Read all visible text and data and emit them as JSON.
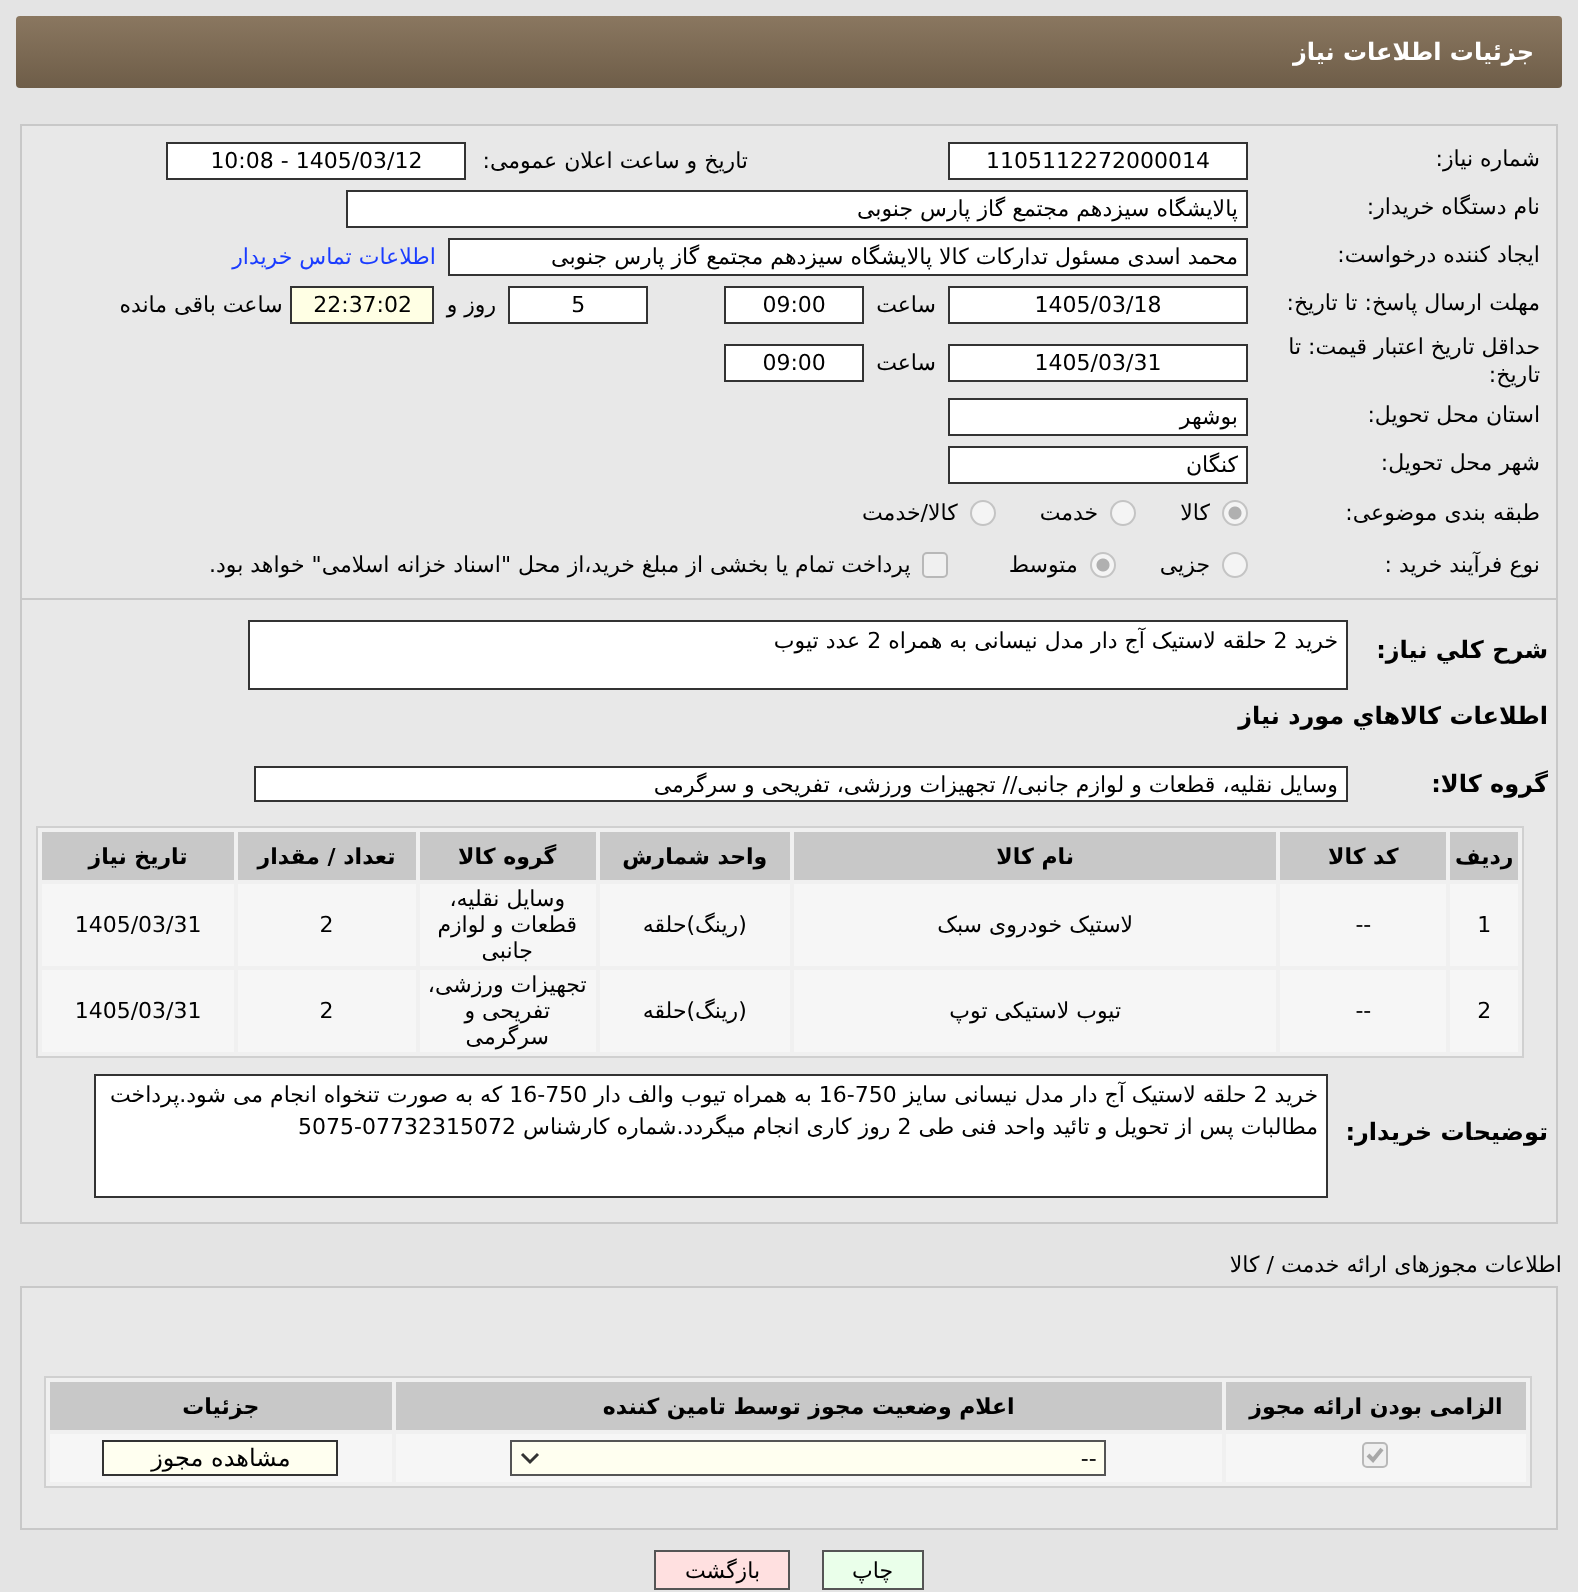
{
  "header": {
    "title": "جزئیات اطلاعات نیاز"
  },
  "form": {
    "need_number": {
      "label": "شماره نیاز:",
      "value": "1105112272000014"
    },
    "announce": {
      "label": "تاریخ و ساعت اعلان عمومی:",
      "value": "1405/03/12 - 10:08"
    },
    "buyer": {
      "label": "نام دستگاه خریدار:",
      "value": "پالایشگاه سیزدهم مجتمع گاز پارس جنوبی"
    },
    "creator": {
      "label": "ایجاد کننده درخواست:",
      "value": "محمد اسدی مسئول تدارکات کالا پالایشگاه سیزدهم مجتمع گاز پارس جنوبی",
      "link": "اطلاعات تماس خریدار"
    },
    "deadline": {
      "label": "مهلت ارسال پاسخ: تا تاریخ:",
      "date": "1405/03/18",
      "time_label": "ساعت",
      "time": "09:00",
      "days": "5",
      "days_label": "روز و",
      "remaining": "22:37:02",
      "remaining_label": "ساعت باقی مانده"
    },
    "validity": {
      "label": "حداقل تاریخ اعتبار قیمت: تا تاریخ:",
      "date": "1405/03/31",
      "time_label": "ساعت",
      "time": "09:00"
    },
    "province": {
      "label": "استان محل تحویل:",
      "value": "بوشهر"
    },
    "city": {
      "label": "شهر محل تحویل:",
      "value": "کنگان"
    },
    "category": {
      "label": "طبقه بندی موضوعی:",
      "options": [
        {
          "label": "کالا",
          "selected": true
        },
        {
          "label": "خدمت",
          "selected": false
        },
        {
          "label": "کالا/خدمت",
          "selected": false
        }
      ]
    },
    "process": {
      "label": "نوع فرآیند خرید :",
      "options": [
        {
          "label": "جزیی",
          "selected": false
        },
        {
          "label": "متوسط",
          "selected": true
        }
      ],
      "payment": {
        "checked": false,
        "label": "پرداخت تمام یا بخشی از مبلغ خرید،از محل \"اسناد خزانه اسلامی\" خواهد بود."
      }
    }
  },
  "summary": {
    "description": {
      "label": "شرح كلي نياز:",
      "value": "خرید 2 حلقه لاستیک آج دار مدل نیسانی به همراه 2 عدد تیوب"
    },
    "items_title": "اطلاعات كالاهاي مورد نياز",
    "goods_group": {
      "label": "گروه کالا:",
      "value": "وسایل نقلیه، قطعات و لوازم جانبی// تجهیزات ورزشی، تفریحی و سرگرمی"
    },
    "table": {
      "columns": [
        "ردیف",
        "کد کالا",
        "نام کالا",
        "واحد شمارش",
        "گروه کالا",
        "تعداد / مقدار",
        "تاریخ نیاز"
      ],
      "rows": [
        [
          "1",
          "--",
          "لاستیک خودروی سبک",
          "(رینگ)حلقه",
          "وسایل نقلیه، قطعات و لوازم جانبی",
          "2",
          "1405/03/31"
        ],
        [
          "2",
          "--",
          "تیوب لاستیکی توپ",
          "(رینگ)حلقه",
          "تجهیزات ورزشی، تفریحی و سرگرمی",
          "2",
          "1405/03/31"
        ]
      ]
    },
    "notes": {
      "label": "توضیحات خریدار:",
      "value": "خرید 2 حلقه لاستیک آج دار مدل نیسانی سایز 750-16 به همراه تیوب والف دار 750-16 که به صورت تنخواه انجام می شود.پرداخت مطالبات پس از تحویل و تائید واحد فنی طی 2 روز کاری انجام میگردد.شماره کارشناس 07732315072-5075"
    }
  },
  "permits": {
    "title": "اطلاعات مجوزهای ارائه خدمت / کالا",
    "columns": [
      "الزامی بودن ارائه مجوز",
      "اعلام وضعیت مجوز توسط تامین کننده",
      "جزئیات"
    ],
    "rows": [
      {
        "required": true,
        "status": "--",
        "button": "مشاهده مجوز"
      }
    ]
  },
  "buttons": [
    {
      "label": "چاپ",
      "kind": "print"
    },
    {
      "label": "بازگشت",
      "kind": "back"
    }
  ]
}
